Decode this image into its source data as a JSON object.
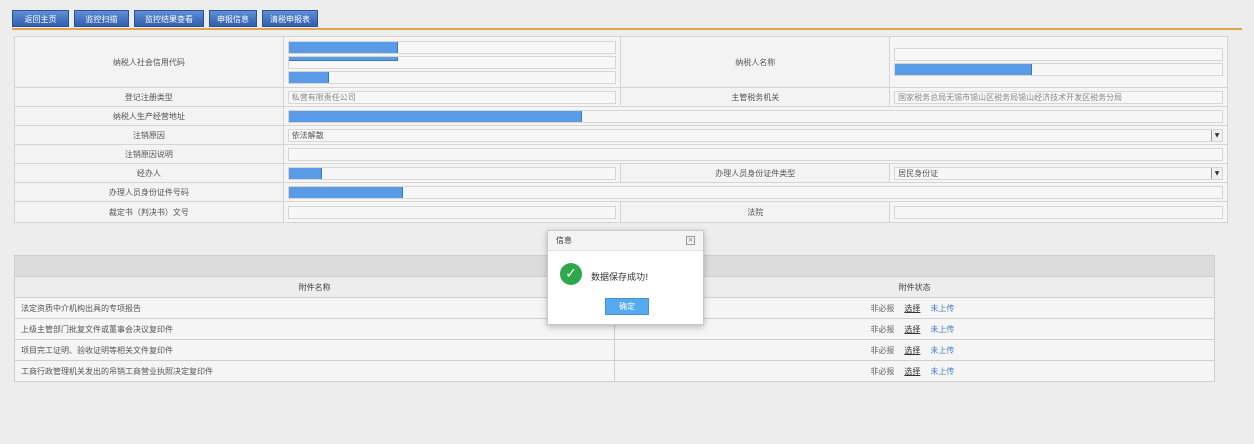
{
  "toolbar": {
    "buttons": [
      "返回主页",
      "监控扫描",
      "监控结果查看",
      "申报信息",
      "清税申报表"
    ]
  },
  "form": {
    "credit_code_label": "纳税人社会信用代码",
    "taxpayer_name_label": "纳税人名称",
    "reg_type_label": "登记注册类型",
    "reg_type_value": "私营有限责任公司",
    "tax_authority_label": "主管税务机关",
    "tax_authority_value": "国家税务总局无锡市锡山区税务局锡山经济技术开发区税务分局",
    "address_label": "纳税人生产经营地址",
    "reason_label": "注销原因",
    "reason_value": "依法解散",
    "reason_desc_label": "注销原因说明",
    "handler_label": "经办人",
    "id_type_label": "办理人员身份证件类型",
    "id_type_value": "居民身份证",
    "id_number_label": "办理人员身份证件号码",
    "ruling_label": "裁定书（判决书）文号",
    "court_label": "法院"
  },
  "attachments": {
    "col_name": "附件名称",
    "col_status": "附件状态",
    "rows": [
      {
        "name": "法定资质中介机构出具的专项报告",
        "required": "非必报",
        "choose": "选择",
        "status": "未上传"
      },
      {
        "name": "上级主管部门批复文件或董事会决议复印件",
        "required": "非必报",
        "choose": "选择",
        "status": "未上传"
      },
      {
        "name": "项目完工证明、验收证明等相关文件复印件",
        "required": "非必报",
        "choose": "选择",
        "status": "未上传"
      },
      {
        "name": "工商行政管理机关发出的吊销工商营业执照决定复印件",
        "required": "非必报",
        "choose": "选择",
        "status": "未上传"
      }
    ]
  },
  "dialog": {
    "title": "信息",
    "message": "数据保存成功!",
    "ok": "确定"
  }
}
